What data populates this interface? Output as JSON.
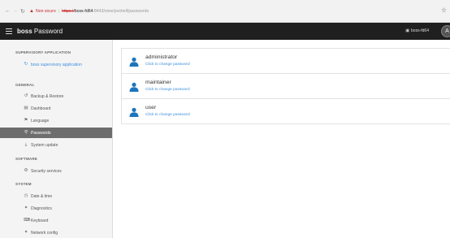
{
  "browser": {
    "not_secure": "Non sicuro",
    "scheme": "https://",
    "host": "boss-fd64",
    "port": ":8443",
    "path": "/view/pvshell/passwords"
  },
  "header": {
    "title_bold": "boss",
    "title_rest": " Password",
    "host_label": "boss-fd64",
    "avatar_letter": "A"
  },
  "sidebar": {
    "supervisory_title": "SUPERVISORY APPLICATION",
    "supervisory_item": "boss supervisory application",
    "general_title": "GENERAL",
    "general_items": [
      "Backup & Restore",
      "Dashboard",
      "Language",
      "Passwords",
      "System update"
    ],
    "software_title": "SOFTWARE",
    "software_items": [
      "Security services"
    ],
    "system_title": "SYSTEM",
    "system_items": [
      "Date & time",
      "Diagnostics",
      "Keyboard",
      "Network config"
    ]
  },
  "users": [
    {
      "name": "administrator",
      "action": "Click to change password"
    },
    {
      "name": "maintainer",
      "action": "Click to change password"
    },
    {
      "name": "user",
      "action": "Click to change password"
    }
  ],
  "colors": {
    "header_bg": "#1f1f1f",
    "active_item_bg": "#6d6d6d",
    "link": "#3e8edc",
    "user_icon": "#1c75bc",
    "warning": "#c62828"
  }
}
